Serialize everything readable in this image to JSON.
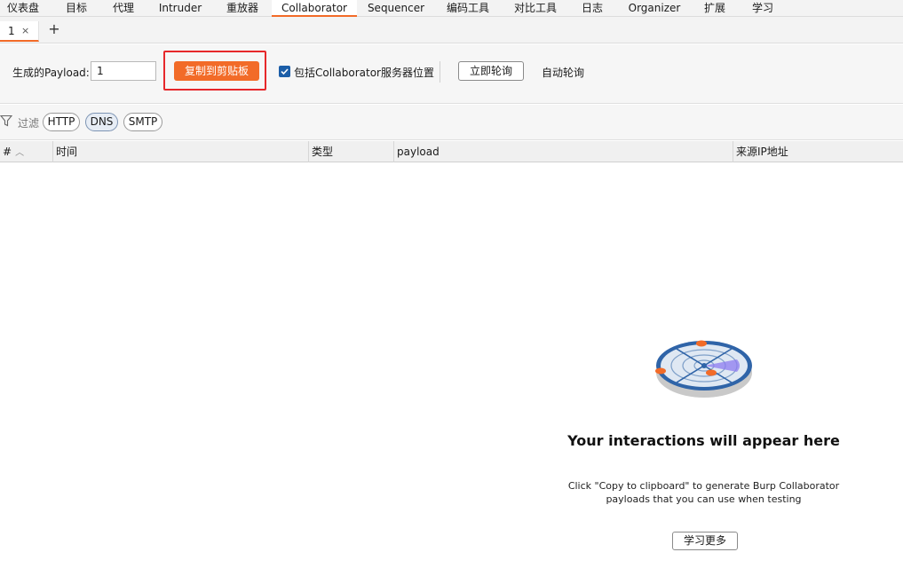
{
  "nav": {
    "tabs": [
      "仪表盘",
      "目标",
      "代理",
      "Intruder",
      "重放器",
      "Collaborator",
      "Sequencer",
      "编码工具",
      "对比工具",
      "日志",
      "Organizer",
      "扩展",
      "学习"
    ],
    "active": "Collaborator"
  },
  "subtabs": {
    "tab1_label": "1",
    "close_glyph": "×",
    "add_glyph": "+"
  },
  "toolbar": {
    "payload_label": "生成的Payload:",
    "payload_value": "1",
    "copy_button": "复制到剪贴板",
    "include_location_label": "包括Collaborator服务器位置",
    "include_location_checked": true,
    "poll_now_button": "立即轮询",
    "auto_poll_label": "自动轮询"
  },
  "filter": {
    "label": "过滤",
    "chips": [
      {
        "label": "HTTP",
        "active": false
      },
      {
        "label": "DNS",
        "active": true
      },
      {
        "label": "SMTP",
        "active": false
      }
    ]
  },
  "table": {
    "columns": [
      "#",
      "时间",
      "类型",
      "payload",
      "来源IP地址"
    ]
  },
  "empty_state": {
    "title": "Your interactions will appear here",
    "description": "Click \"Copy to clipboard\" to generate Burp Collaborator payloads that you can use when testing",
    "learn_more_button": "学习更多"
  },
  "colors": {
    "accent": "#f26b28",
    "highlight_border": "#e6282b",
    "checkbox": "#1c5ea8",
    "radar_ring": "#2f64a8"
  }
}
